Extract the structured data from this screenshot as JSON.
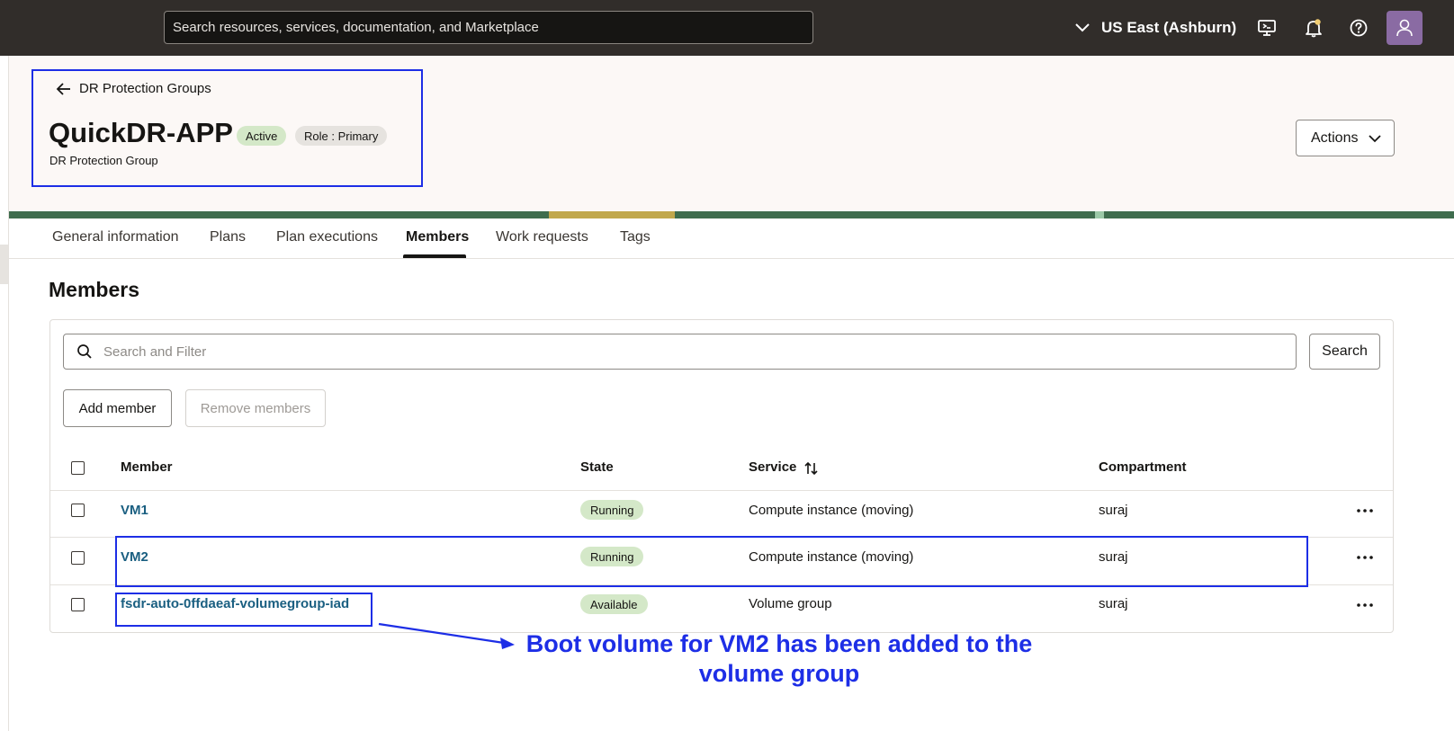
{
  "topbar": {
    "search_placeholder": "Search resources, services, documentation, and Marketplace",
    "region": "US East (Ashburn)",
    "icons": [
      "chevron-down-icon",
      "cloud-shell-icon",
      "bell-icon",
      "help-icon",
      "user-icon"
    ]
  },
  "header": {
    "back_label": "DR Protection Groups",
    "title": "QuickDR-APP",
    "badge_state": "Active",
    "badge_role": "Role : Primary",
    "subtitle": "DR Protection Group",
    "actions_label": "Actions"
  },
  "tabs": [
    {
      "label": "General information"
    },
    {
      "label": "Plans"
    },
    {
      "label": "Plan executions"
    },
    {
      "label": "Members",
      "active": true
    },
    {
      "label": "Work requests"
    },
    {
      "label": "Tags"
    }
  ],
  "members": {
    "section_title": "Members",
    "filter_placeholder": "Search and Filter",
    "search_label": "Search",
    "add_label": "Add member",
    "remove_label": "Remove members",
    "columns": [
      "Member",
      "State",
      "Service",
      "Compartment"
    ],
    "rows": [
      {
        "member": "VM1",
        "state": "Running",
        "service": "Compute instance (moving)",
        "compartment": "suraj"
      },
      {
        "member": "VM2",
        "state": "Running",
        "service": "Compute instance (moving)",
        "compartment": "suraj"
      },
      {
        "member": "fsdr-auto-0ffdaeaf-volumegroup-iad",
        "state": "Available",
        "service": "Volume group",
        "compartment": "suraj"
      }
    ]
  },
  "annotation": {
    "text_line1": "Boot volume for VM2 has been added to the",
    "text_line2": "volume group",
    "color": "#1d2ee6"
  },
  "colors": {
    "topbar": "#312d2a",
    "link": "#1a5f81",
    "badge_green": "#d4e8c8",
    "badge_gray": "#e6e3df"
  }
}
